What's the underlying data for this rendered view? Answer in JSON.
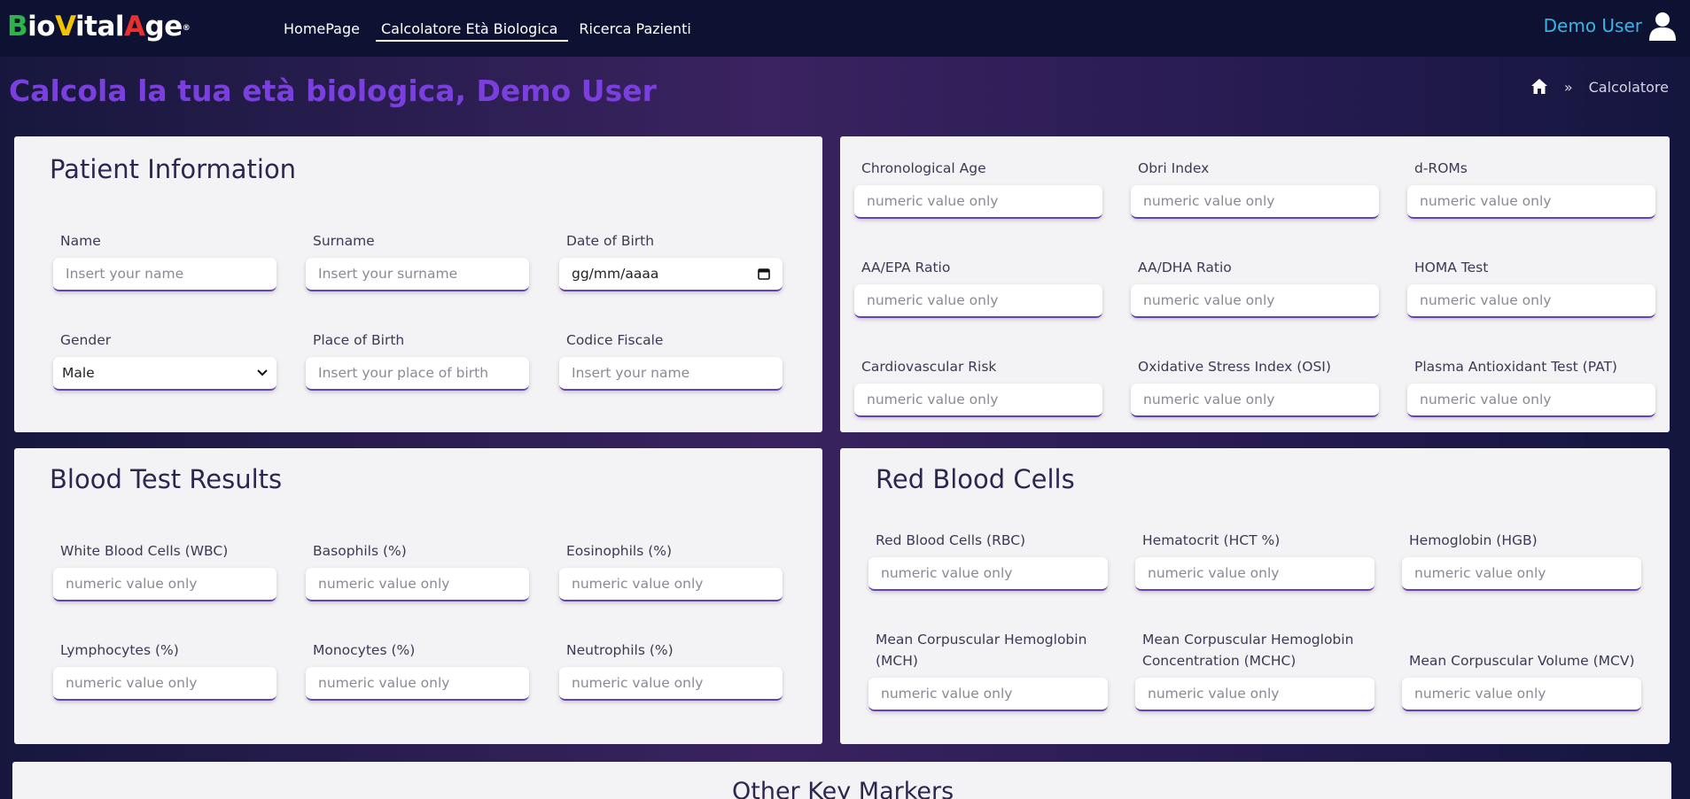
{
  "nav": {
    "logo": {
      "b": "B",
      "io": "io",
      "v": "V",
      "ital": "ital",
      "a": "A",
      "ge": "ge",
      "reg": "®"
    },
    "links": [
      "HomePage",
      "Calcolatore Età Biologica",
      "Ricerca Pazienti"
    ],
    "user_name": "Demo User"
  },
  "header": {
    "title": "Calcola la tua età biologica, Demo User",
    "breadcrumb_sep": "»",
    "breadcrumb_current": "Calcolatore"
  },
  "patient": {
    "title": "Patient Information",
    "name_label": "Name",
    "name_placeholder": "Insert your name",
    "surname_label": "Surname",
    "surname_placeholder": "Insert your surname",
    "dob_label": "Date of Birth",
    "dob_value": "gg/mm/aaaa",
    "gender_label": "Gender",
    "gender_value": "Male",
    "pob_label": "Place of Birth",
    "pob_placeholder": "Insert your place of birth",
    "cf_label": "Codice Fiscale",
    "cf_placeholder": "Insert your name"
  },
  "markers": {
    "placeholder": "numeric value only",
    "fields": [
      "Chronological Age",
      "Obri Index",
      "d-ROMs",
      "AA/EPA Ratio",
      "AA/DHA Ratio",
      "HOMA Test",
      "Cardiovascular Risk",
      "Oxidative Stress Index (OSI)",
      "Plasma Antioxidant Test (PAT)"
    ]
  },
  "blood": {
    "title": "Blood Test Results",
    "placeholder": "numeric value only",
    "fields": [
      "White Blood Cells (WBC)",
      "Basophils (%)",
      "Eosinophils (%)",
      "Lymphocytes (%)",
      "Monocytes (%)",
      "Neutrophils (%)"
    ]
  },
  "rbc": {
    "title": "Red Blood Cells",
    "placeholder": "numeric value only",
    "fields": [
      "Red Blood Cells (RBC)",
      "Hematocrit (HCT %)",
      "Hemoglobin (HGB)",
      "Mean Corpuscular Hemoglobin (MCH)",
      "Mean Corpuscular Hemoglobin Concentration (MCHC)",
      "Mean Corpuscular Volume (MCV)"
    ]
  },
  "other": {
    "title": "Other Key Markers"
  }
}
